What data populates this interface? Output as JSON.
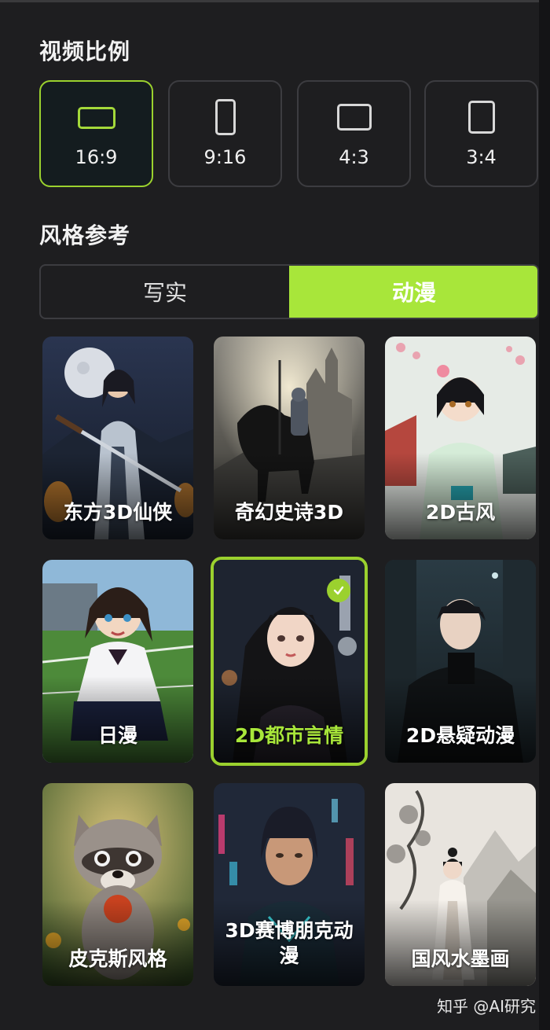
{
  "aspect_section": {
    "title": "视频比例",
    "options": [
      {
        "label": "16:9",
        "selected": true
      },
      {
        "label": "9:16",
        "selected": false
      },
      {
        "label": "4:3",
        "selected": false
      },
      {
        "label": "3:4",
        "selected": false
      }
    ]
  },
  "style_section": {
    "title": "风格参考",
    "tabs": [
      {
        "label": "写实",
        "active": false
      },
      {
        "label": "动漫",
        "active": true
      }
    ],
    "cards": [
      {
        "label": "东方3D仙侠",
        "selected": false
      },
      {
        "label": "奇幻史诗3D",
        "selected": false
      },
      {
        "label": "2D古风",
        "selected": false
      },
      {
        "label": "日漫",
        "selected": false
      },
      {
        "label": "2D都市言情",
        "selected": true
      },
      {
        "label": "2D悬疑动漫",
        "selected": false
      },
      {
        "label": "皮克斯风格",
        "selected": false
      },
      {
        "label": "3D赛博朋克动漫",
        "selected": false
      },
      {
        "label": "国风水墨画",
        "selected": false
      }
    ]
  },
  "watermark": "知乎 @AI研究",
  "colors": {
    "accent": "#9bd12e",
    "accent_fill": "#a8e63a",
    "background": "#1e1e20",
    "border": "#3c3c40"
  }
}
